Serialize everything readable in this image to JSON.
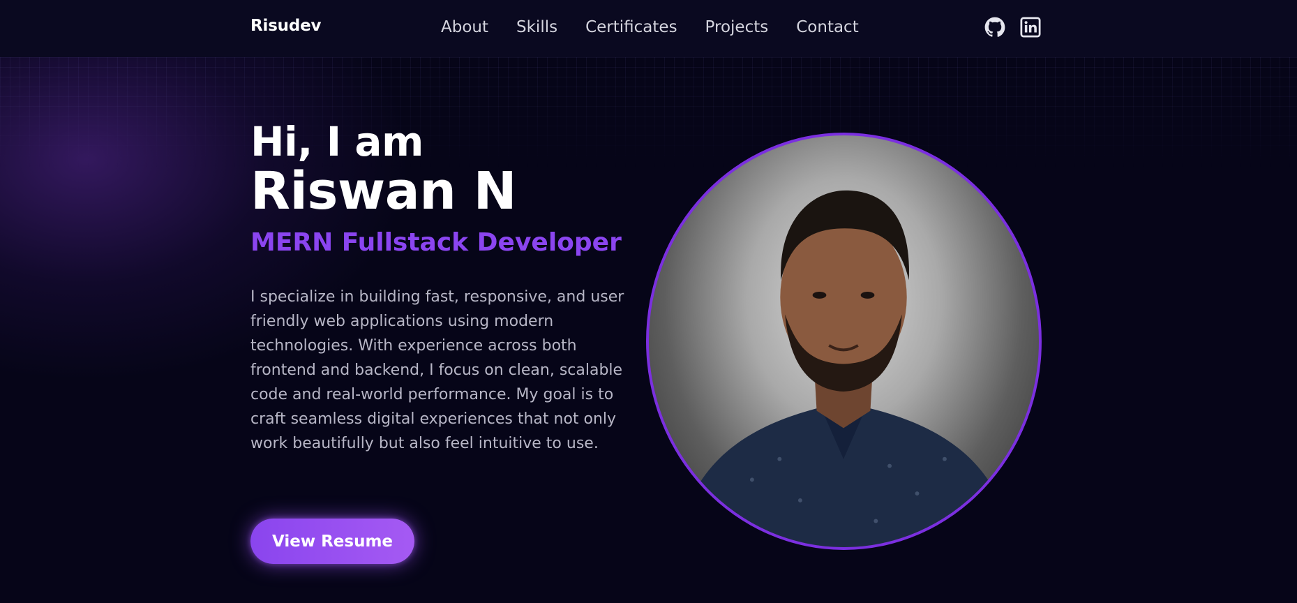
{
  "header": {
    "brand": "Risudev",
    "nav": [
      "About",
      "Skills",
      "Certificates",
      "Projects",
      "Contact"
    ],
    "socials": [
      "github-icon",
      "linkedin-icon"
    ]
  },
  "hero": {
    "greeting": "Hi, I am",
    "name": "Riswan N",
    "role": "MERN Fullstack Developer",
    "description": "I specialize in building fast, responsive, and user friendly web applications using modern technologies. With experience across both frontend and backend, I focus on clean, scalable code and real-world performance. My goal is to craft seamless digital experiences that not only work beautifully but also feel intuitive to use.",
    "cta": "View Resume"
  },
  "colors": {
    "background": "#060518",
    "accent": "#8b45f0",
    "photo_border": "#7b2fe0",
    "text_muted": "#b7b6c6"
  }
}
